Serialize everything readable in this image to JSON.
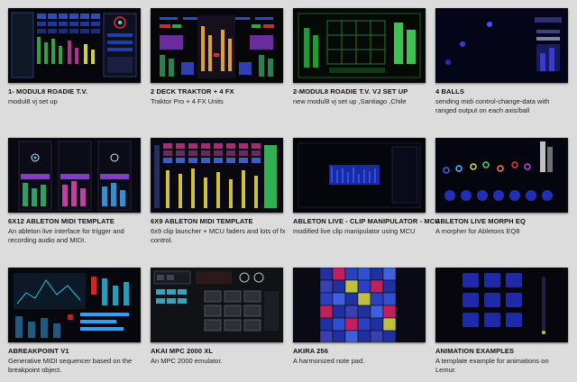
{
  "items": [
    {
      "title": "1- MODUL8 ROADIE T.V.",
      "desc": "modul8 vj set up",
      "thumb_icon": "modul8-roadie-thumbnail"
    },
    {
      "title": "2 DECK TRAKTOR + 4 FX",
      "desc": "Traktor Pro + 4 FX Units",
      "thumb_icon": "traktor-thumbnail"
    },
    {
      "title": "2-MODUL8 ROADIE T.V. VJ SET UP",
      "desc": "new modul8 vj set up ,Santiago ,Chile",
      "thumb_icon": "modul8-vj-thumbnail"
    },
    {
      "title": "4 BALLS",
      "desc": "sending midi control-change-data with ranged output on each axis/ball",
      "thumb_icon": "four-balls-thumbnail"
    },
    {
      "title": "6X12 ABLETON MIDI TEMPLATE",
      "desc": "An ableton live interface for trigger and recording audio and MIDI.",
      "thumb_icon": "ableton-6x12-thumbnail"
    },
    {
      "title": "6X9 ABLETON MIDI TEMPLATE",
      "desc": "6x9 clip launcher + MCU faders and lots of fx control.",
      "thumb_icon": "ableton-6x9-thumbnail"
    },
    {
      "title": "ABLETON LIVE - CLIP MANIPULATOR - MCU",
      "desc": "modified live clip manipulator using MCU",
      "thumb_icon": "clip-manipulator-thumbnail"
    },
    {
      "title": "ABLETON LIVE MORPH EQ",
      "desc": "A morpher for Abletons EQ8",
      "thumb_icon": "morph-eq-thumbnail"
    },
    {
      "title": "ABREAKPOINT V1",
      "desc": "Generative MIDI sequencer based on the breakpoint object.",
      "thumb_icon": "abreakpoint-thumbnail"
    },
    {
      "title": "AKAI MPC 2000 XL",
      "desc": "An MPC 2000 emulator.",
      "thumb_icon": "mpc-thumbnail"
    },
    {
      "title": "AKIRA 256",
      "desc": "A harmonized note pad.",
      "thumb_icon": "akira-thumbnail"
    },
    {
      "title": "ANIMATION EXAMPLES",
      "desc": "A template example for animations on Lemur.",
      "thumb_icon": "animation-thumbnail"
    }
  ]
}
